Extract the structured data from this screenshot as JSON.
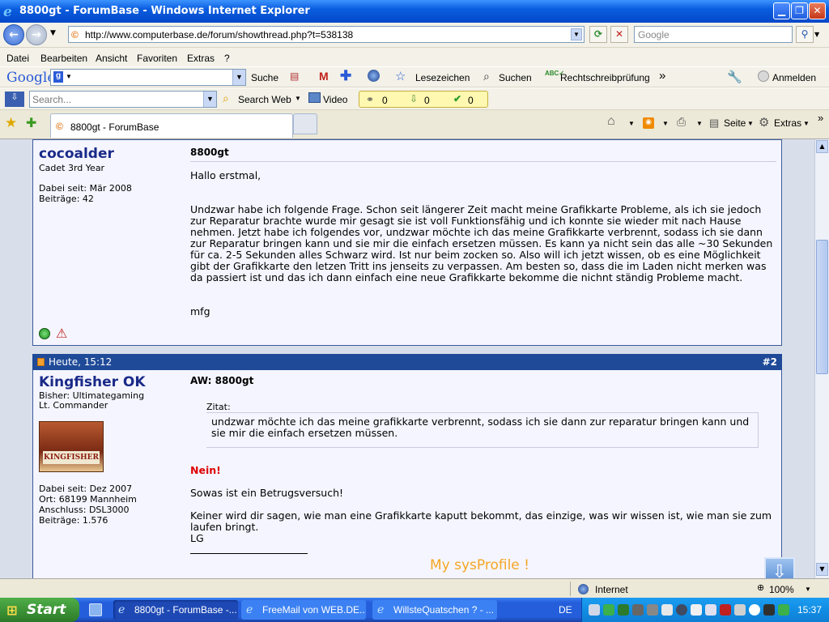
{
  "window": {
    "title": "8800gt - ForumBase - Windows Internet Explorer"
  },
  "address_bar": {
    "url": "http://www.computerbase.de/forum/showthread.php?t=538138",
    "search_placeholder": "Google"
  },
  "menu": {
    "items": [
      "Datei",
      "Bearbeiten",
      "Ansicht",
      "Favoriten",
      "Extras",
      "?"
    ]
  },
  "google_toolbar": {
    "logo": "Google",
    "search_label": "Suche",
    "bookmarks_label": "Lesezeichen",
    "find_label": "Suchen",
    "spellcheck_label": "Rechtschreibprüfung",
    "more": "»",
    "signin_label": "Anmelden"
  },
  "search_toolbar": {
    "placeholder": "Search...",
    "search_web_label": "Search Web",
    "video_label": "Video",
    "counters": [
      "0",
      "0",
      "0"
    ]
  },
  "tabs": {
    "active_label": "8800gt - ForumBase",
    "page_label": "Seite",
    "extras_label": "Extras",
    "more": "»"
  },
  "posts": [
    {
      "username": "cocoalder",
      "rank": "Cadet 3rd Year",
      "joined": "Dabei seit: Mär 2008",
      "posts_count": "Beiträge: 42",
      "title": "8800gt",
      "greeting": "Hallo erstmal,",
      "body": "Undzwar habe ich folgende Frage. Schon seit längerer Zeit macht meine Grafikkarte Probleme, als ich sie jedoch zur Reparatur brachte wurde mir gesagt sie ist voll Funktionsfähig und ich konnte sie wieder mit nach Hause nehmen. Jetzt habe ich folgendes vor, undzwar möchte ich das meine Grafikkarte verbrennt, sodass ich sie dann zur Reparatur bringen kann und sie mir die einfach ersetzen müssen. Es kann ya nicht sein das alle ~30 Sekunden für ca. 2-5 Sekunden alles Schwarz wird. Ist nur beim zocken so. Also will ich jetzt wissen, ob es eine Möglichkeit gibt der Grafikkarte den letzen Tritt ins jenseits zu verpassen. Am besten so, dass die im Laden nicht merken was da passiert ist und das ich dann einfach eine neue Grafikkarte bekomme die nichnt ständig Probleme macht.",
      "signoff": "mfg"
    },
    {
      "date": "Heute, 15:12",
      "number": "#2",
      "username": "Kingfisher OK",
      "subtitle": "Bisher: Ultimategaming",
      "rank": "Lt. Commander",
      "avatar_text": "KINGFISHER",
      "joined": "Dabei seit: Dez 2007",
      "location": "Ort: 68199 Mannheim",
      "connection": "Anschluss: DSL3000",
      "posts_count": "Beiträge: 1.576",
      "title": "AW: 8800gt",
      "quote_label": "Zitat:",
      "quote": "undzwar möchte ich das meine grafikkarte verbrennt, sodass ich sie dann zur reparatur bringen kann und sie mir die einfach ersetzen müssen.",
      "exclaim": "Nein!",
      "line1": "Sowas ist ein Betrugsversuch!",
      "line2": "Keiner wird dir sagen, wie man eine Grafikkarte kaputt bekommt, das einzige, was wir wissen ist, wie man sie zum laufen bringt.",
      "line3": "LG",
      "signature_title": "My sysProfile !"
    }
  ],
  "status_bar": {
    "zone": "Internet",
    "zoom": "100%"
  },
  "taskbar": {
    "start_label": "Start",
    "items": [
      "8800gt - ForumBase -...",
      "FreeMail von WEB.DE...",
      "WillsteQuatschen ? - ..."
    ],
    "language": "DE",
    "clock": "15:37"
  },
  "colors": {
    "title_blue": "#0a5ddf",
    "post_header": "#1f4a98",
    "username": "#1a2a88",
    "nein_red": "#dd0000",
    "sysprofile_orange": "#f5a623"
  }
}
